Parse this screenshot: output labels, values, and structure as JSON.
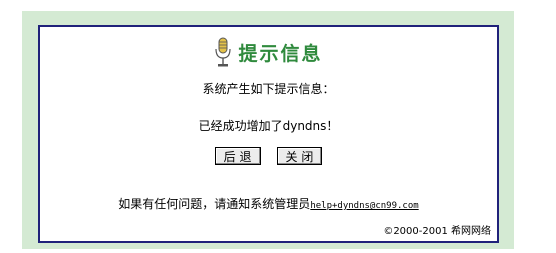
{
  "header": {
    "title": "提示信息",
    "icon": "microphone-icon",
    "title_color": "#2f8a3d"
  },
  "message": {
    "intro": "系统产生如下提示信息：",
    "detail": "已经成功增加了dyndns！"
  },
  "buttons": {
    "back_label": "后 退",
    "close_label": "关 闭"
  },
  "contact": {
    "text": "如果有任何问题，请通知系统管理员",
    "email": "help+dyndns@cn99.com"
  },
  "footer": {
    "copyright": "©2000-2001  希网网络"
  },
  "colors": {
    "frame_bg": "#d4ead3",
    "border": "#20227a"
  }
}
